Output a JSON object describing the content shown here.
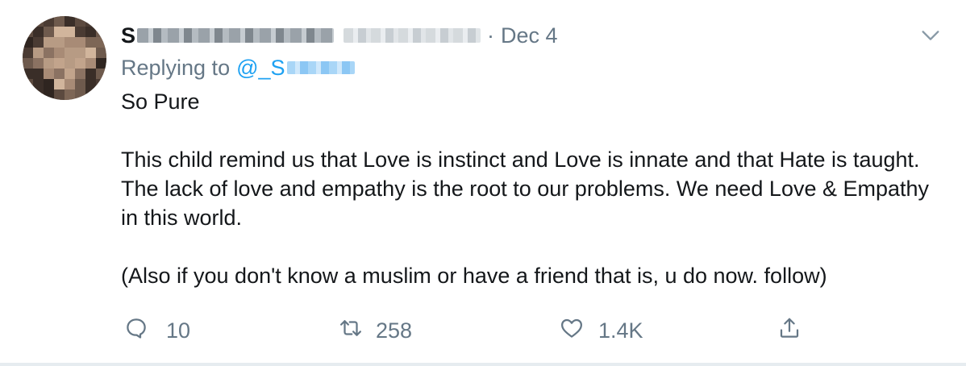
{
  "tweet": {
    "author": {
      "name_visible": "S",
      "date": "Dec 4",
      "separator": "·"
    },
    "replying": {
      "prefix": "Replying to",
      "handle_visible": "@_S"
    },
    "text": {
      "line1": "So Pure",
      "paragraph2": "This child remind us that Love is instinct and Love is innate and that Hate is taught. The lack of love and empathy is the root to our problems. We need Love & Empathy in this world.",
      "paragraph3": "(Also if you don't know a muslim or have a friend that is, u do now. follow)"
    },
    "actions": {
      "reply_count": "10",
      "retweet_count": "258",
      "like_count": "1.4K"
    },
    "icons": {
      "reply": "reply-icon",
      "retweet": "retweet-icon",
      "like": "heart-icon",
      "share": "share-icon",
      "menu": "chevron-down-icon"
    },
    "colors": {
      "text": "#14171a",
      "secondary": "#657786",
      "link": "#1da1f2",
      "border": "#e6ecf0"
    }
  }
}
